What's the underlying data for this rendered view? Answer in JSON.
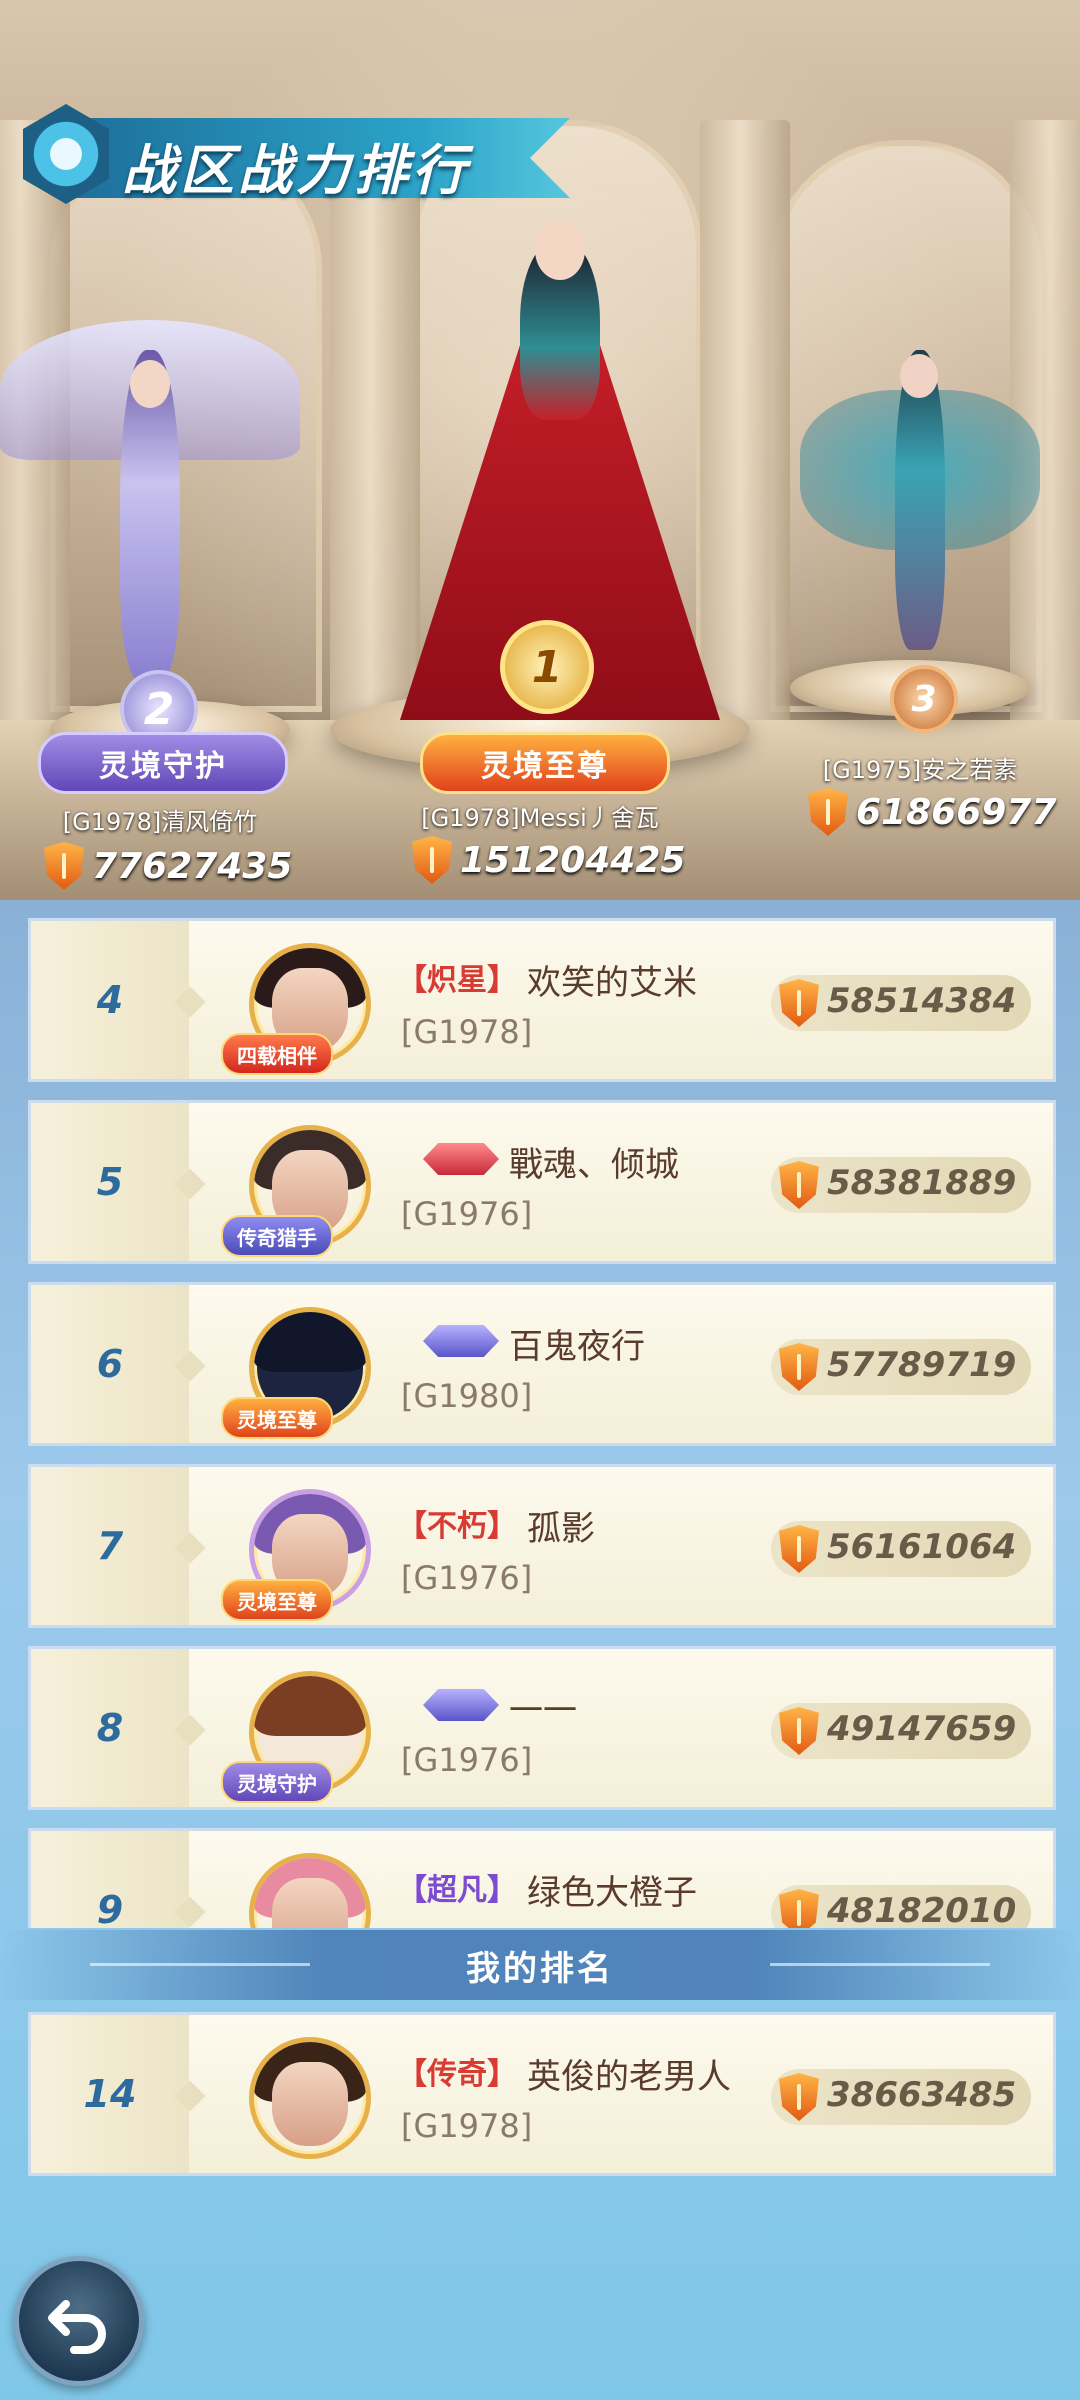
{
  "header": {
    "title": "战区战力排行"
  },
  "podium": [
    {
      "rank": "2",
      "title": "灵境守护",
      "name": "[G1978]清风倚竹",
      "power": "77627435"
    },
    {
      "rank": "1",
      "title": "灵境至尊",
      "name": "[G1978]Messi丿舍瓦",
      "power": "151204425"
    },
    {
      "rank": "3",
      "title": "",
      "name": "[G1975]安之若素",
      "power": "61866977"
    }
  ],
  "ranking": [
    {
      "rank": "4",
      "badge": "四载相伴",
      "vip": "【炽星】",
      "name": "欢笑的艾米",
      "server": "[G1978]",
      "power": "58514384"
    },
    {
      "rank": "5",
      "badge": "传奇猎手",
      "vip": "",
      "name": "戰魂、倾城",
      "server": "[G1976]",
      "power": "58381889"
    },
    {
      "rank": "6",
      "badge": "灵境至尊",
      "vip": "",
      "name": "百鬼夜行",
      "server": "[G1980]",
      "power": "57789719"
    },
    {
      "rank": "7",
      "badge": "灵境至尊",
      "vip": "【不朽】",
      "name": "孤影",
      "server": "[G1976]",
      "power": "56161064"
    },
    {
      "rank": "8",
      "badge": "灵境守护",
      "vip": "",
      "name": "一一",
      "server": "[G1976]",
      "power": "49147659"
    },
    {
      "rank": "9",
      "badge": "",
      "vip": "【超凡】",
      "name": "绿色大橙子",
      "server": "",
      "power": "48182010"
    }
  ],
  "my_rank": {
    "header": "我的排名",
    "rank": "14",
    "vip": "【传奇】",
    "name": "英俊的老男人",
    "server": "[G1978]",
    "power": "38663485"
  },
  "icons": {
    "power": "shield-sword-icon",
    "back": "back-arrow-icon"
  },
  "colors": {
    "accent": "#2d6b9e",
    "gold": "#e7b14a",
    "vip_red": "#d83b33",
    "vip_purple": "#7d4bd0"
  }
}
